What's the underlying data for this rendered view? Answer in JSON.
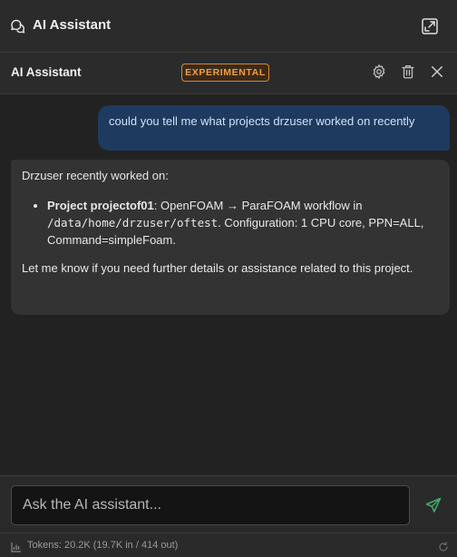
{
  "window": {
    "title": "AI Assistant",
    "icons": {
      "title": "chat-bubbles-icon",
      "expand": "pop-out-icon"
    }
  },
  "header": {
    "title": "AI Assistant",
    "badge": "EXPERIMENTAL",
    "icons": [
      "gear-icon",
      "trash-icon",
      "close-icon"
    ],
    "badge_color": "#f0a040"
  },
  "messages": {
    "user": "could you tell me what projects drzuser worked on recently",
    "assistant": {
      "intro": "Drzuser recently worked on:",
      "item_title": "Project projectof01",
      "item_text_1": ": OpenFOAM → ParaFOAM workflow in ",
      "item_path": "/data/home/drzuser/oftest",
      "item_text_2": ". Configuration: 1 CPU core, PPN=ALL, Command=simpleFoam.",
      "closing": "Let me know if you need further details or assistance related to this project."
    }
  },
  "composer": {
    "placeholder": "Ask the AI assistant...",
    "value": "",
    "send_icon": "send-icon",
    "send_color": "#3fae6a"
  },
  "status": {
    "tokens": "Tokens: 20.2K (19.7K in / 414 out)",
    "icons": [
      "bar-chart-icon",
      "reset-icon"
    ]
  },
  "colors": {
    "user_bubble": "#1e3a5f",
    "assistant_bubble": "#333333",
    "background": "#222222"
  }
}
